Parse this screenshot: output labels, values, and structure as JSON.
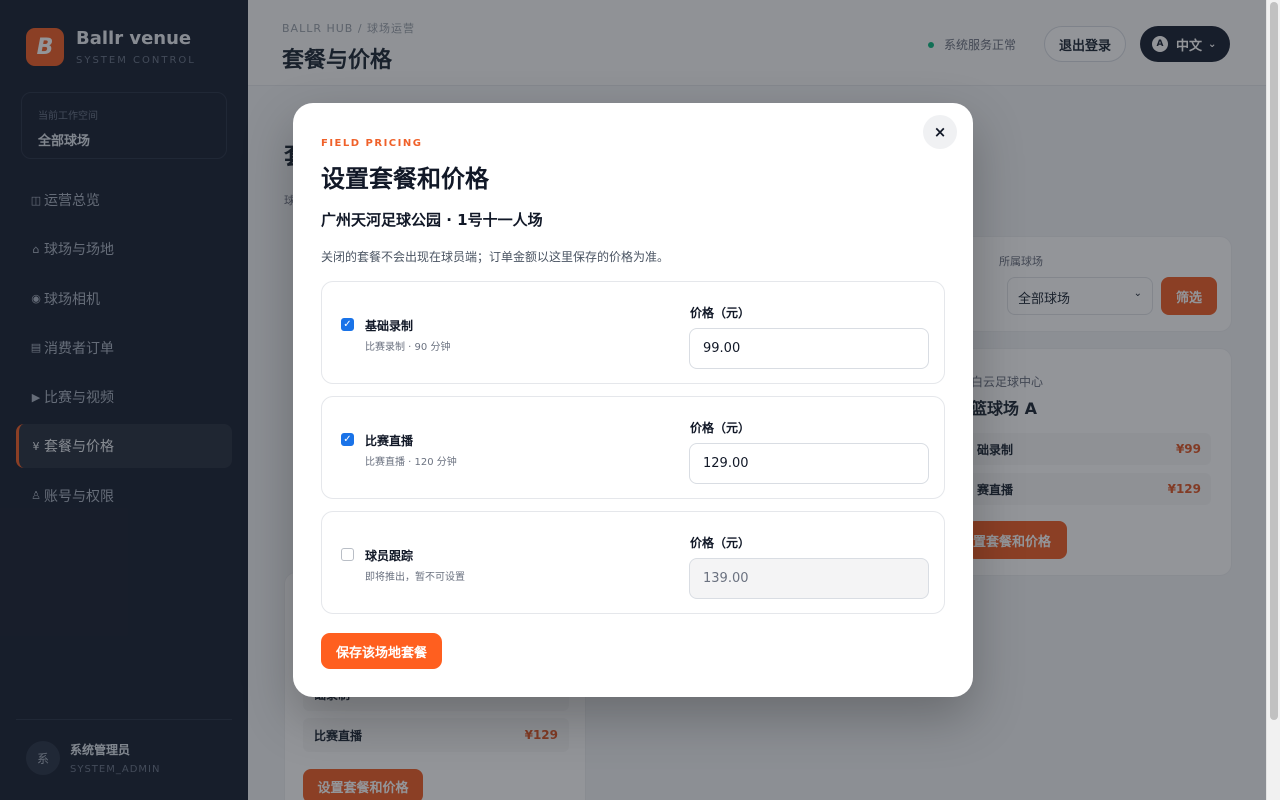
{
  "brand": {
    "logo_letter": "B",
    "name": "Ballr venue",
    "subtitle": "SYSTEM CONTROL",
    "accent_color": "#f0612a"
  },
  "workspace": {
    "label": "当前工作空间",
    "value": "全部球场"
  },
  "sidebar": {
    "items": [
      {
        "icon": "◫",
        "label": "运营总览"
      },
      {
        "icon": "⌂",
        "label": "球场与场地"
      },
      {
        "icon": "◉",
        "label": "球场相机"
      },
      {
        "icon": "▤",
        "label": "消费者订单"
      },
      {
        "icon": "▶",
        "label": "比赛与视频"
      },
      {
        "icon": "¥",
        "label": "套餐与价格",
        "active": true
      },
      {
        "icon": "♙",
        "label": "账号与权限"
      }
    ]
  },
  "user": {
    "avatar": "系",
    "name": "系统管理员",
    "role": "SYSTEM_ADMIN"
  },
  "header": {
    "breadcrumb": "BALLR HUB / 球场运营",
    "title": "套餐与价格",
    "status": "系统服务正常",
    "logout_label": "退出登录",
    "lang_badge": "A",
    "lang_label": "中文",
    "status_color": "#10b981"
  },
  "background": {
    "title_fragment": "套",
    "subtitle_fragment": "球",
    "filter": {
      "label": "所属球场",
      "select_value": "全部球场",
      "button": "筛选"
    },
    "venue_card": {
      "venue": "白云足球中心",
      "field": "篮球场 A",
      "rows": [
        {
          "name": "础录制",
          "price": "¥99"
        },
        {
          "name": "赛直播",
          "price": "¥129"
        }
      ],
      "button": "置套餐和价格"
    },
    "left_card": {
      "rows": [
        {
          "name": "础录制",
          "price": ""
        },
        {
          "name": "比赛直播",
          "price": "¥129"
        }
      ],
      "button": "设置套餐和价格"
    }
  },
  "modal": {
    "close_icon": "×",
    "eyebrow": "FIELD PRICING",
    "title": "设置套餐和价格",
    "venue_field": "广州天河足球公园 · 1号十一人场",
    "note": "关闭的套餐不会出现在球员端；订单金额以这里保存的价格为准。",
    "packages": [
      {
        "name": "基础录制",
        "desc": "比赛录制 · 90 分钟",
        "price_label": "价格（元）",
        "price": "99.00",
        "enabled": true
      },
      {
        "name": "比赛直播",
        "desc": "比赛直播 · 120 分钟",
        "price_label": "价格（元）",
        "price": "129.00",
        "enabled": true
      },
      {
        "name": "球员跟踪",
        "desc": "即将推出，暂不可设置",
        "price_label": "价格（元）",
        "price": "139.00",
        "enabled": false
      }
    ],
    "save_label": "保存该场地套餐"
  }
}
